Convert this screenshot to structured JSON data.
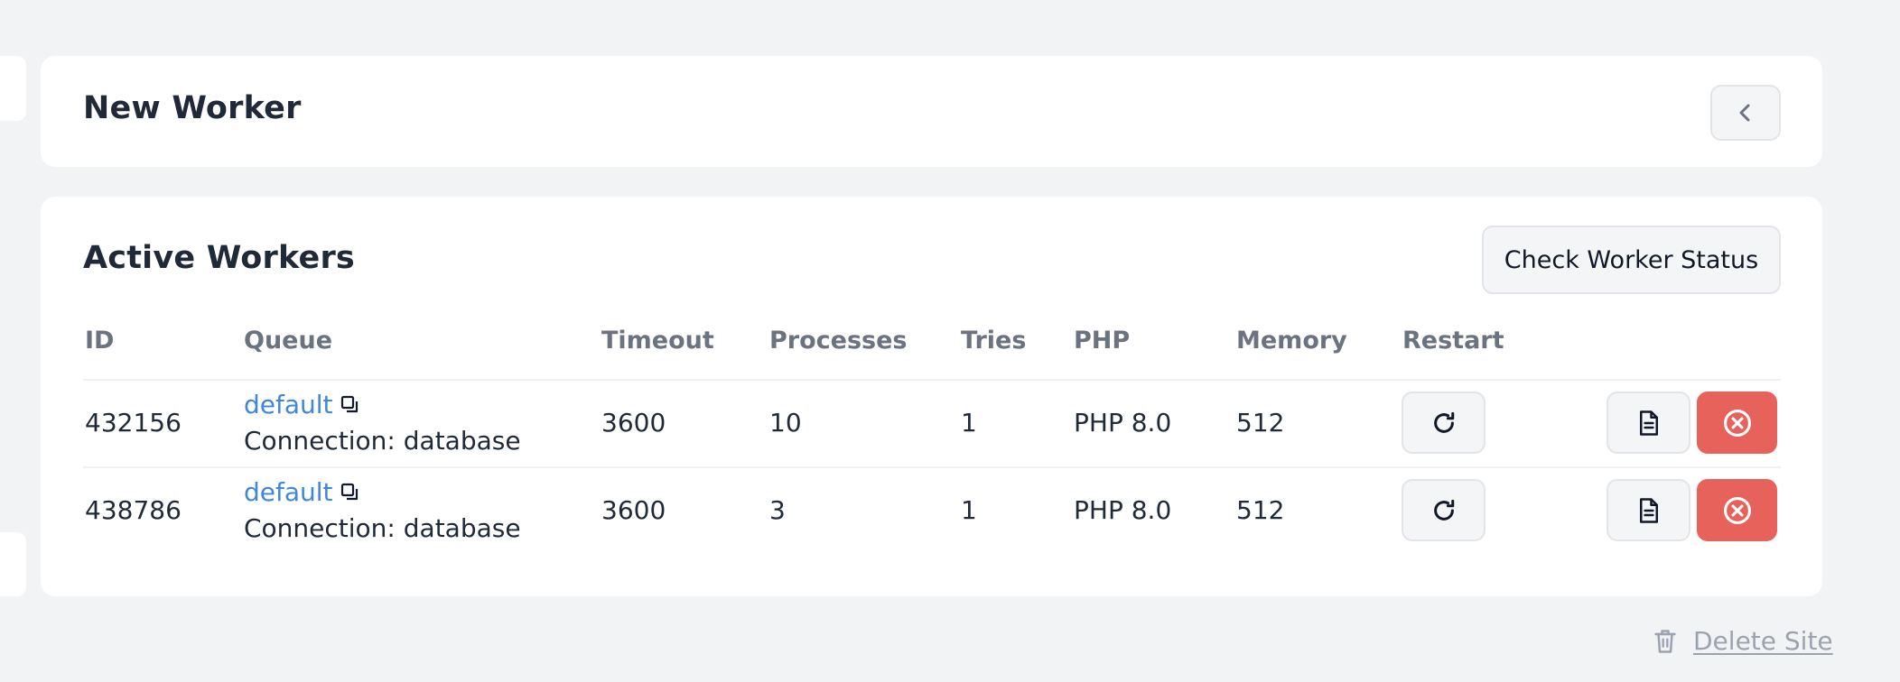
{
  "new_worker": {
    "title": "New Worker",
    "collapse_icon": "chevron-left-icon"
  },
  "active_workers": {
    "title": "Active Workers",
    "check_status_label": "Check Worker Status",
    "columns": {
      "id": "ID",
      "queue": "Queue",
      "timeout": "Timeout",
      "processes": "Processes",
      "tries": "Tries",
      "php": "PHP",
      "memory": "Memory",
      "restart": "Restart"
    },
    "rows": [
      {
        "id": "432156",
        "queue": "default",
        "connection": "Connection: database",
        "timeout": "3600",
        "processes": "10",
        "tries": "1",
        "php": "PHP 8.0",
        "memory": "512"
      },
      {
        "id": "438786",
        "queue": "default",
        "connection": "Connection: database",
        "timeout": "3600",
        "processes": "3",
        "tries": "1",
        "php": "PHP 8.0",
        "memory": "512"
      }
    ],
    "row_icons": {
      "copy": "copy-icon",
      "restart": "refresh-icon",
      "logs": "document-icon",
      "remove": "close-circle-icon"
    }
  },
  "footer": {
    "delete_site_label": "Delete Site",
    "delete_icon": "trash-icon"
  },
  "colors": {
    "background": "#f2f3f5",
    "card": "#ffffff",
    "link": "#3f86dd",
    "danger": "#e8625c",
    "muted": "#6b7280"
  }
}
